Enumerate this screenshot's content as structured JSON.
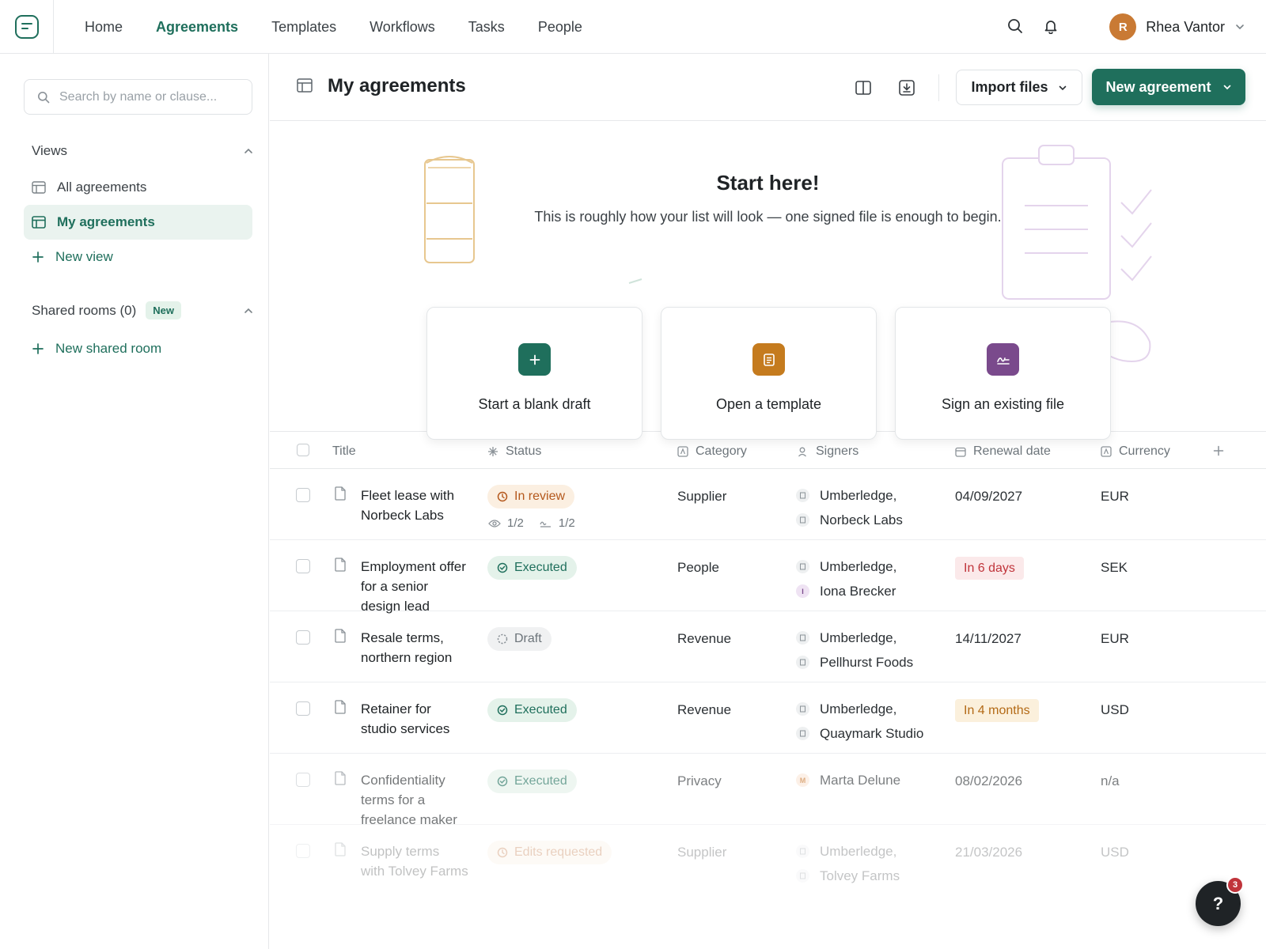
{
  "nav": {
    "tabs": [
      {
        "label": "Home"
      },
      {
        "label": "Agreements"
      },
      {
        "label": "Templates"
      },
      {
        "label": "Workflows"
      },
      {
        "label": "Tasks"
      },
      {
        "label": "People"
      }
    ],
    "active_tab": "Agreements",
    "user": {
      "initial": "R",
      "name": "Rhea Vantor"
    }
  },
  "sidebar": {
    "search_placeholder": "Search by name or clause...",
    "views_heading": "Views",
    "views": [
      {
        "label": "All agreements"
      },
      {
        "label": "My agreements"
      }
    ],
    "new_view_label": "New view",
    "shared_heading": "Shared rooms (0)",
    "shared_badge": "New",
    "new_shared_label": "New shared room"
  },
  "header": {
    "title": "My agreements",
    "import_label": "Import files",
    "new_label": "New agreement"
  },
  "hero": {
    "title": "Start here!",
    "subtitle": "This is roughly how your list will look — one signed file is enough to begin.",
    "cards": [
      {
        "label": "Start a blank draft",
        "color": "#1f6f5c",
        "icon": "plus-icon"
      },
      {
        "label": "Open a template",
        "color": "#c57b1e",
        "icon": "template-icon"
      },
      {
        "label": "Sign an existing file",
        "color": "#7a4a8c",
        "icon": "signature-icon"
      }
    ]
  },
  "table": {
    "columns": [
      "Title",
      "Status",
      "Category",
      "Signers",
      "Renewal date",
      "Currency"
    ],
    "rows": [
      {
        "title_lines": [
          "Fleet lease with",
          "Norbeck Labs"
        ],
        "status": "In review",
        "status_kind": "review",
        "views": "1/2",
        "signed": "1/2",
        "category": "Supplier",
        "signers": [
          "Umberledge,",
          "Norbeck Labs"
        ],
        "renewal": "04/09/2027",
        "renewal_kind": "plain",
        "currency": "EUR"
      },
      {
        "title_lines": [
          "Employment offer",
          "for a senior",
          "design lead"
        ],
        "status": "Executed",
        "status_kind": "executed",
        "category": "People",
        "signers": [
          "Umberledge,",
          "Iona Brecker"
        ],
        "signer_initial": "I",
        "renewal": "In 6 days",
        "renewal_kind": "red",
        "currency": "SEK"
      },
      {
        "title_lines": [
          "Resale terms,",
          "northern region"
        ],
        "status": "Draft",
        "status_kind": "draft",
        "category": "Revenue",
        "signers": [
          "Umberledge,",
          "Pellhurst Foods"
        ],
        "renewal": "14/11/2027",
        "renewal_kind": "plain",
        "currency": "EUR"
      },
      {
        "title_lines": [
          "Retainer for",
          "studio services"
        ],
        "status": "Executed",
        "status_kind": "executed",
        "category": "Revenue",
        "signers": [
          "Umberledge,",
          "Quaymark Studio"
        ],
        "renewal": "In 4 months",
        "renewal_kind": "amber",
        "currency": "USD"
      },
      {
        "title_lines": [
          "Confidentiality",
          "terms for a",
          "freelance maker"
        ],
        "status": "Executed",
        "status_kind": "executed",
        "category": "Privacy",
        "signers": [
          "Marta Delune"
        ],
        "signer_initial": "M",
        "renewal": "08/02/2026",
        "renewal_kind": "plain",
        "currency": "n/a"
      },
      {
        "title_lines": [
          "Supply terms",
          "with Tolvey Farms"
        ],
        "status": "Edits requested",
        "status_kind": "edits",
        "category": "Supplier",
        "signers": [
          "Umberledge,",
          "Tolvey Farms"
        ],
        "renewal": "21/03/2026",
        "renewal_kind": "plain",
        "currency": "USD"
      }
    ]
  },
  "help": {
    "label": "?",
    "badge": "3"
  },
  "colors": {
    "brand": "#1f6f5c",
    "review": "#b4581c",
    "danger": "#c0343b"
  }
}
